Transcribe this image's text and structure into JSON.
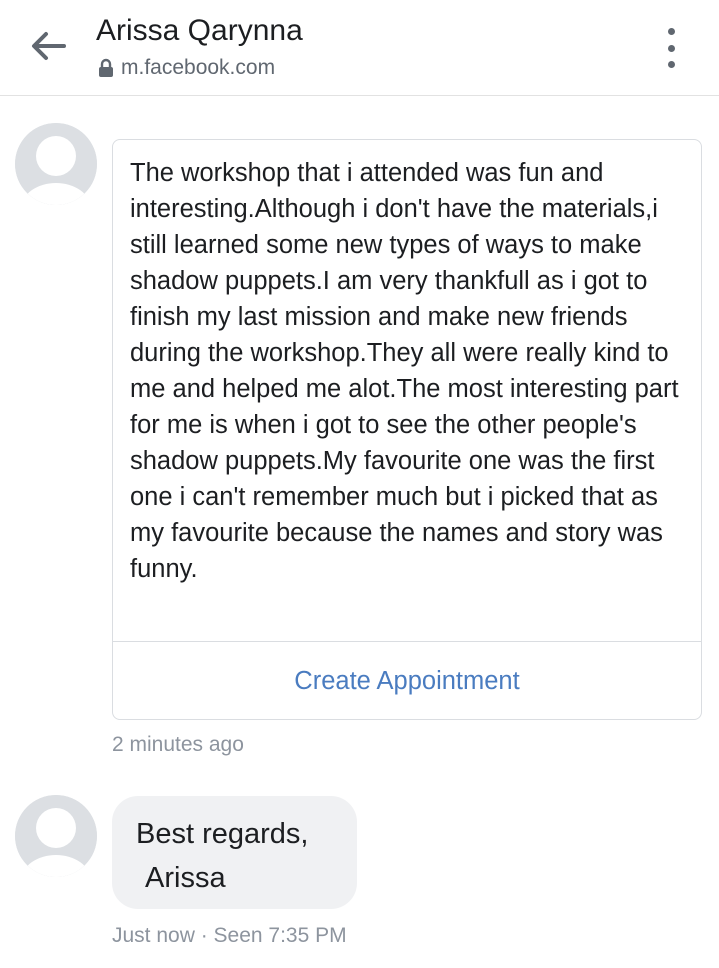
{
  "header": {
    "title": "Arissa Qarynna",
    "url": "m.facebook.com",
    "back_icon": "arrow-left-icon",
    "lock_icon": "lock-icon",
    "menu_icon": "more-vertical-icon"
  },
  "conversation": {
    "message_card": {
      "text": "The workshop that i attended was fun and interesting.Although i don't have the materials,i still learned some new types of ways to make shadow puppets.I am very thankfull as i got to finish my last mission and make new friends during the workshop.They all were really kind to me and helped me alot.The most interesting part for me is when i got to see the other people's shadow puppets.My favourite one was the first one i can't remember much but i picked that as my favourite because the names and story was funny.",
      "action_label": "Create Appointment",
      "timestamp": "2 minutes ago"
    },
    "message_bubble": {
      "line1": "Best regards,",
      "line2": "Arissa",
      "status": "Just now · Seen 7:35 PM"
    }
  },
  "colors": {
    "link": "#4a7cc0",
    "text": "#1c1e21",
    "muted": "#8d949e",
    "bubble_bg": "#f0f1f3",
    "avatar_bg": "#dcdfe3"
  }
}
